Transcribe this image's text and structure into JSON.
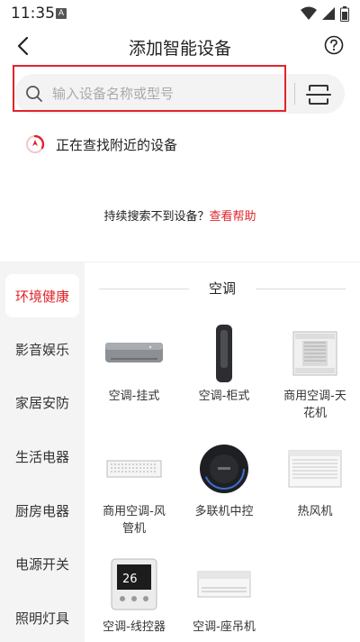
{
  "status_bar": {
    "time": "11:35",
    "notification_icon": "A"
  },
  "header": {
    "title": "添加智能设备"
  },
  "search": {
    "placeholder": "输入设备名称或型号",
    "value": ""
  },
  "scan_status": {
    "text": "正在查找附近的设备"
  },
  "help": {
    "prefix": "持续搜索不到设备？",
    "link": "查看帮助"
  },
  "categories": [
    {
      "label": "环境健康",
      "active": true
    },
    {
      "label": "影音娱乐",
      "active": false
    },
    {
      "label": "家居安防",
      "active": false
    },
    {
      "label": "生活电器",
      "active": false
    },
    {
      "label": "厨房电器",
      "active": false
    },
    {
      "label": "电源开关",
      "active": false
    },
    {
      "label": "照明灯具",
      "active": false
    }
  ],
  "content": {
    "section_title": "空调",
    "devices": [
      {
        "line1": "空调-挂式",
        "line2": "",
        "icon": "wall-ac-icon"
      },
      {
        "line1": "空调-柜式",
        "line2": "",
        "icon": "floor-ac-icon"
      },
      {
        "line1": "商用空调-天",
        "line2": "花机",
        "icon": "ceiling-cassette-ac-icon"
      },
      {
        "line1": "商用空调-风",
        "line2": "管机",
        "icon": "duct-ac-icon"
      },
      {
        "line1": "多联机中控",
        "line2": "",
        "icon": "central-controller-icon"
      },
      {
        "line1": "热风机",
        "line2": "",
        "icon": "heater-icon"
      },
      {
        "line1": "空调-线控器",
        "line2": "",
        "icon": "wired-controller-icon"
      },
      {
        "line1": "空调-座吊机",
        "line2": "",
        "icon": "ceiling-floor-ac-icon"
      }
    ]
  },
  "colors": {
    "accent": "#e0242a",
    "sidebar_bg": "#f4f4f4"
  }
}
